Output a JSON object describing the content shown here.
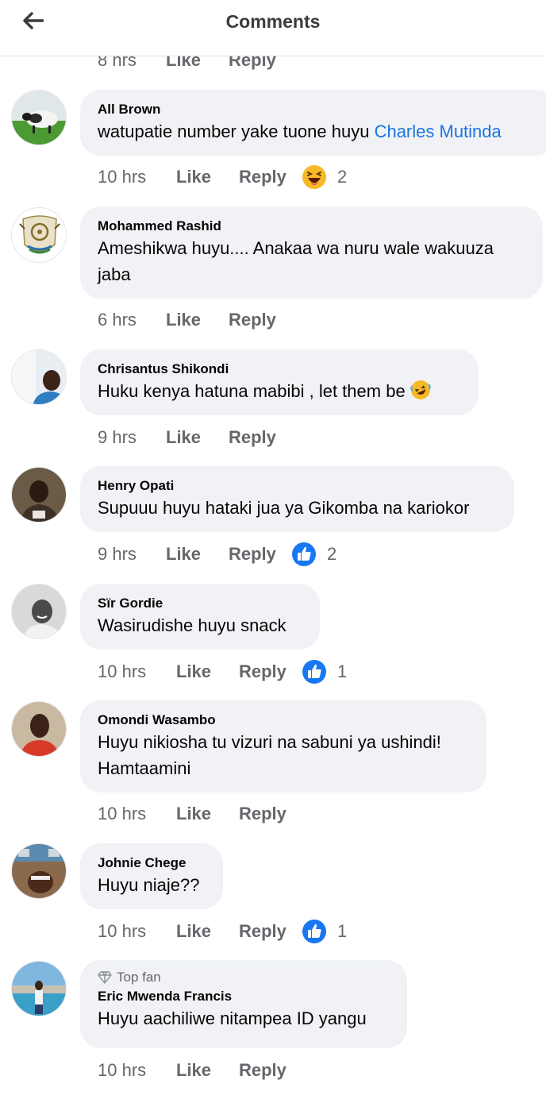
{
  "header": {
    "title": "Comments"
  },
  "partial_top": {
    "time": "8 hrs",
    "like": "Like",
    "reply": "Reply"
  },
  "comments": [
    {
      "author": "All Brown",
      "text": "watupatie number yake tuone huyu",
      "mention": "Charles Mutinda",
      "time": "10 hrs",
      "like": "Like",
      "reply": "Reply",
      "reaction": "laugh",
      "reaction_count": "2"
    },
    {
      "author": "Mohammed Rashid",
      "text": "Ameshikwa huyu.... Anakaa wa nuru wale wakuuza jaba",
      "time": "6 hrs",
      "like": "Like",
      "reply": "Reply"
    },
    {
      "author": "Chrisantus Shikondi",
      "text": "Huku kenya hatuna mabibi , let them be",
      "emoji": "rolling-laugh",
      "time": "9 hrs",
      "like": "Like",
      "reply": "Reply"
    },
    {
      "author": "Henry Opati",
      "text": "Supuuu huyu hataki jua ya Gikomba na kariokor",
      "time": "9 hrs",
      "like": "Like",
      "reply": "Reply",
      "reaction": "like",
      "reaction_count": "2"
    },
    {
      "author": "Sïr Gordie",
      "text": "Wasirudishe huyu snack",
      "time": "10 hrs",
      "like": "Like",
      "reply": "Reply",
      "reaction": "like",
      "reaction_count": "1"
    },
    {
      "author": "Omondi Wasambo",
      "text": "Huyu nikiosha tu vizuri na sabuni ya ushindi! Hamtaamini",
      "time": "10 hrs",
      "like": "Like",
      "reply": "Reply"
    },
    {
      "author": "Johnie Chege",
      "text": "Huyu niaje??",
      "time": "10 hrs",
      "like": "Like",
      "reply": "Reply",
      "reaction": "like",
      "reaction_count": "1"
    },
    {
      "badge": "Top fan",
      "author": "Eric Mwenda Francis",
      "text": "Huyu aachiliwe nitampea ID yangu",
      "time": "10 hrs",
      "like": "Like",
      "reply": "Reply"
    }
  ],
  "colors": {
    "link": "#1b74e4",
    "like_blue": "#1877f2",
    "bubble": "#f0f2f5",
    "meta": "#65676b"
  }
}
